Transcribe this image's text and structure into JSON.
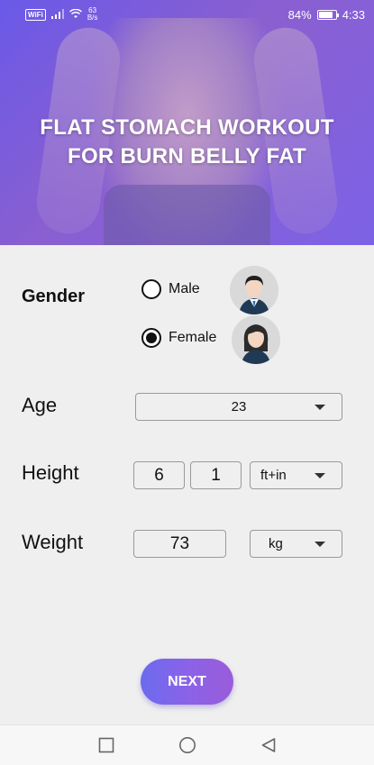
{
  "status_bar": {
    "wifi_badge": "WiFi",
    "net_speed_value": "63",
    "net_speed_unit": "B/s",
    "battery_percent": "84%",
    "battery_level": 0.84,
    "time": "4:33"
  },
  "hero": {
    "title_line1": "FLAT STOMACH WORKOUT",
    "title_line2": "FOR BURN BELLY FAT"
  },
  "form": {
    "gender_label": "Gender",
    "gender_options": [
      {
        "label": "Male",
        "selected": false,
        "icon": "male-avatar-icon"
      },
      {
        "label": "Female",
        "selected": true,
        "icon": "female-avatar-icon"
      }
    ],
    "age_label": "Age",
    "age_value": "23",
    "height_label": "Height",
    "height_ft": "6",
    "height_in": "1",
    "height_unit": "ft+in",
    "weight_label": "Weight",
    "weight_value": "73",
    "weight_unit": "kg"
  },
  "actions": {
    "next_label": "NEXT"
  },
  "colors": {
    "accent_start": "#6b6bee",
    "accent_end": "#9a5cd9",
    "background": "#efefef"
  },
  "nav_bar": {
    "icons": [
      "recent-apps-icon",
      "home-icon",
      "back-icon"
    ]
  }
}
